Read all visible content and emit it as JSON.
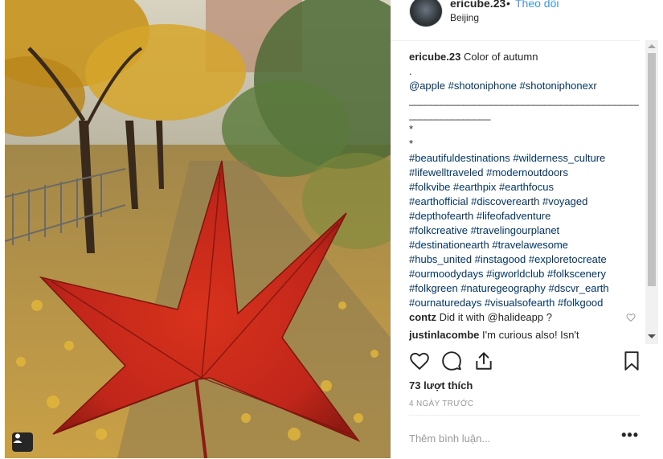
{
  "post": {
    "username": "ericube.23",
    "dot": "•",
    "follow": "Theo dõi",
    "location": "Beijing"
  },
  "caption": {
    "username": "ericube.23",
    "text": "Color of autumn",
    "line_dot": ".",
    "mentions": "@apple #shotoniphone #shotoniphonexr",
    "separator1": "_______________________________________________",
    "separator2": "_______________",
    "star1": "*",
    "star2": "*",
    "hashtags": [
      "#beautifuldestinations #wilderness_culture",
      "#lifewelltraveled #modernoutdoors",
      "#folkvibe #earthpix #earthfocus",
      "#earthofficial #discoverearth #voyaged",
      "#depthofearth #lifeofadventure",
      "#folkcreative #travelingourplanet",
      "#destinationearth #travelawesome",
      "#hubs_united #instagood #exploretocreate",
      "#ourmoodydays #igworldclub #folkscenery",
      "#folkgreen #naturegeography #dscvr_earth",
      "#ournaturedays #visualsofearth #folkgood"
    ]
  },
  "comments": [
    {
      "username": "contz",
      "text": "Did it with @halideapp ?"
    },
    {
      "username": "justinlacombe",
      "text": "I'm curious also! Isn't"
    }
  ],
  "likes": "73 lượt thích",
  "time": "4 NGÀY TRƯỚC",
  "comment_placeholder": "Thêm bình luận...",
  "more_label": "•••",
  "icons": {
    "like": "heart-icon",
    "comment": "comment-icon",
    "share": "share-icon",
    "save": "bookmark-icon",
    "tag": "user-tag-icon"
  },
  "colors": {
    "link": "#3897f0",
    "hashtag": "#003569",
    "leaf": "#c62a1a"
  }
}
